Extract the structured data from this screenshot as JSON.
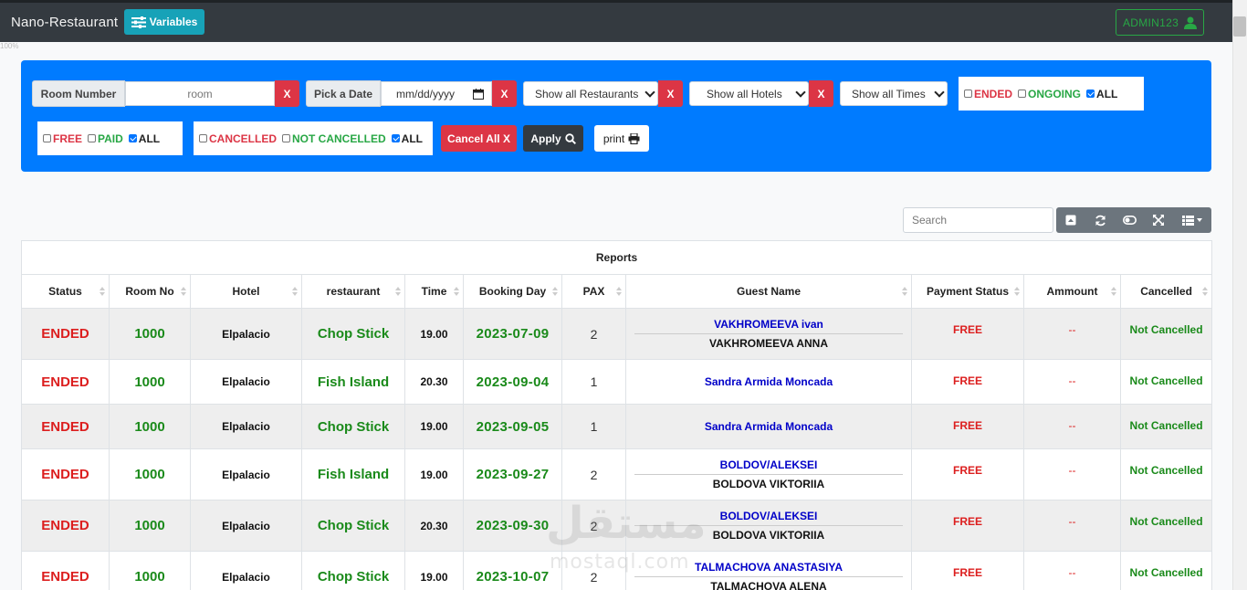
{
  "app": {
    "brand": "Nano-Restaurant",
    "variables_button": "Variables",
    "user_button": "ADMIN123",
    "zoom_text": "100%"
  },
  "filters": {
    "room_label": "Room Number",
    "room_placeholder": "room",
    "date_label": "Pick a Date",
    "date_placeholder": "mm/dd/yyyy",
    "clear_label": "X",
    "restaurant_select": "Show all Restaurants",
    "hotel_select": "Show all Hotels",
    "time_select": "Show all Times",
    "status_options": [
      {
        "label": "ENDED",
        "checked": false,
        "color": "#dc3545"
      },
      {
        "label": "ONGOING",
        "checked": false,
        "color": "#28a745"
      },
      {
        "label": "ALL",
        "checked": true,
        "color": "#222222"
      }
    ],
    "payment_options": [
      {
        "label": "FREE",
        "checked": false,
        "color": "#dc3545"
      },
      {
        "label": "PAID",
        "checked": false,
        "color": "#28a745"
      },
      {
        "label": "ALL",
        "checked": true,
        "color": "#222222"
      }
    ],
    "cancel_options": [
      {
        "label": "CANCELLED",
        "checked": false,
        "color": "#dc3545"
      },
      {
        "label": "NOT CANCELLED",
        "checked": false,
        "color": "#28a745"
      },
      {
        "label": "ALL",
        "checked": true,
        "color": "#222222"
      }
    ],
    "cancel_all_button": "Cancel All X",
    "apply_button": "Apply",
    "print_button": "print"
  },
  "toolbar": {
    "search_placeholder": "Search",
    "icons": [
      "toggle-pagination-icon",
      "refresh-icon",
      "toggle-view-icon",
      "fullscreen-icon",
      "columns-icon"
    ]
  },
  "table": {
    "caption": "Reports",
    "columns": [
      "Status",
      "Room No",
      "Hotel",
      "restaurant",
      "Time",
      "Booking Day",
      "PAX",
      "Guest Name",
      "Payment Status",
      "Ammount",
      "Cancelled"
    ],
    "rows": [
      {
        "status": "ENDED",
        "room": "1000",
        "hotel": "Elpalacio",
        "restaurant": "Chop Stick",
        "time": "19.00",
        "day": "2023-07-09",
        "pax": "2",
        "guest1": "VAKHROMEEVA ivan",
        "guest2": "VAKHROMEEVA ANNA",
        "payment": "FREE",
        "amount": "--",
        "cancelled": "Not Cancelled"
      },
      {
        "status": "ENDED",
        "room": "1000",
        "hotel": "Elpalacio",
        "restaurant": "Fish Island",
        "time": "20.30",
        "day": "2023-09-04",
        "pax": "1",
        "guest1": "Sandra Armida Moncada",
        "guest2": "",
        "payment": "FREE",
        "amount": "--",
        "cancelled": "Not Cancelled"
      },
      {
        "status": "ENDED",
        "room": "1000",
        "hotel": "Elpalacio",
        "restaurant": "Chop Stick",
        "time": "19.00",
        "day": "2023-09-05",
        "pax": "1",
        "guest1": "Sandra Armida Moncada",
        "guest2": "",
        "payment": "FREE",
        "amount": "--",
        "cancelled": "Not Cancelled"
      },
      {
        "status": "ENDED",
        "room": "1000",
        "hotel": "Elpalacio",
        "restaurant": "Fish Island",
        "time": "19.00",
        "day": "2023-09-27",
        "pax": "2",
        "guest1": "BOLDOV/ALEKSEI",
        "guest2": "BOLDOVA VIKTORIIA",
        "payment": "FREE",
        "amount": "--",
        "cancelled": "Not Cancelled"
      },
      {
        "status": "ENDED",
        "room": "1000",
        "hotel": "Elpalacio",
        "restaurant": "Chop Stick",
        "time": "20.30",
        "day": "2023-09-30",
        "pax": "2",
        "guest1": "BOLDOV/ALEKSEI",
        "guest2": "BOLDOVA VIKTORIIA",
        "payment": "FREE",
        "amount": "--",
        "cancelled": "Not Cancelled"
      },
      {
        "status": "ENDED",
        "room": "1000",
        "hotel": "Elpalacio",
        "restaurant": "Chop Stick",
        "time": "19.00",
        "day": "2023-10-07",
        "pax": "2",
        "guest1": "TALMACHOVA ANASTASIYA",
        "guest2": "TALMACHOVA ALENA",
        "payment": "FREE",
        "amount": "--",
        "cancelled": "Not Cancelled"
      }
    ]
  },
  "watermark": {
    "arabic": "مستقل",
    "latin": "mostaql.com"
  }
}
